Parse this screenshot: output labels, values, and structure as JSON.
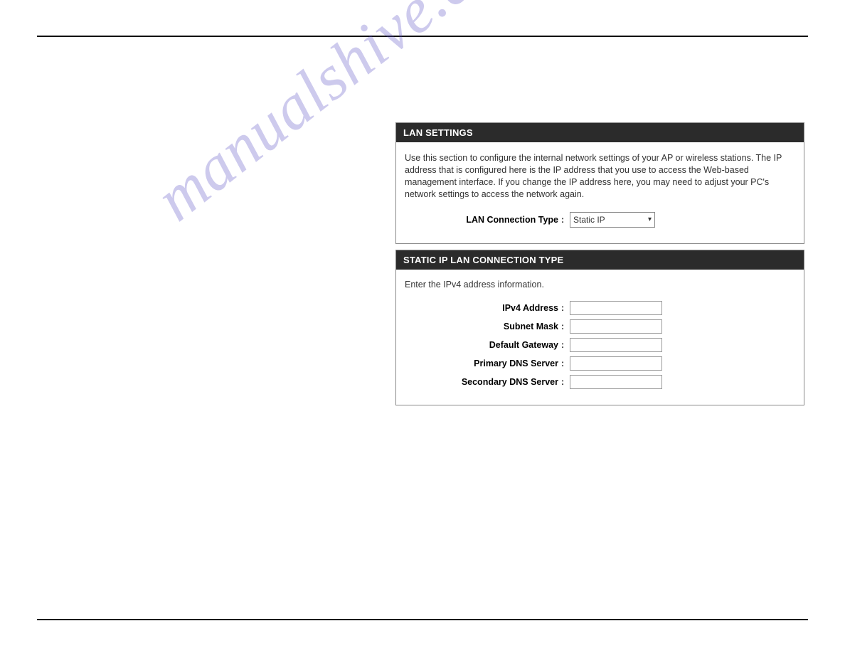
{
  "watermark": "manualshive.com",
  "lanSettings": {
    "title": "LAN SETTINGS",
    "description": "Use this section to configure the internal network settings of your AP or wireless stations. The IP address that is configured here is the IP address that you use to access the Web-based management interface. If you change the IP address here, you may need to adjust your PC's network settings to access the network again.",
    "connTypeLabel": "LAN Connection Type",
    "connTypeValue": "Static IP"
  },
  "staticIp": {
    "title": "STATIC IP LAN CONNECTION TYPE",
    "description": "Enter the IPv4 address information.",
    "fields": {
      "ipv4": {
        "label": "IPv4 Address",
        "value": ""
      },
      "subnet": {
        "label": "Subnet Mask",
        "value": ""
      },
      "gateway": {
        "label": "Default Gateway",
        "value": ""
      },
      "pdns": {
        "label": "Primary DNS Server",
        "value": ""
      },
      "sdns": {
        "label": "Secondary DNS Server",
        "value": ""
      }
    }
  }
}
